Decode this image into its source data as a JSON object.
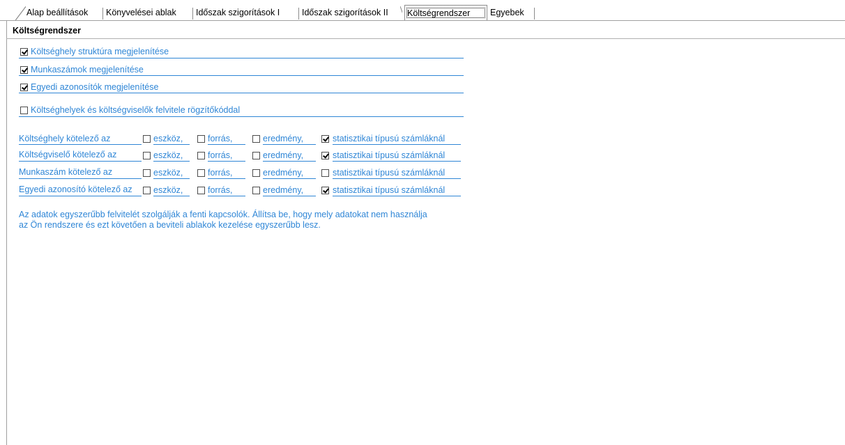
{
  "tabs": [
    {
      "label": "Alap beállítások"
    },
    {
      "label": "Könyvelései ablak"
    },
    {
      "label": "Időszak szigorítások I"
    },
    {
      "label": "Időszak szigorítások II"
    },
    {
      "label": "Költségrendszer",
      "active": true
    },
    {
      "label": "Egyebek"
    }
  ],
  "section_title": "Költségrendszer",
  "options": [
    {
      "label": "Költséghely struktúra megjelenítése",
      "checked": true
    },
    {
      "label": "Munkaszámok megjelenítése",
      "checked": true
    },
    {
      "label": "Egyedi azonosítók megjelenítése",
      "checked": true
    },
    {
      "label": "Költséghelyek és költségviselők felvitele rögzítőkóddal",
      "checked": false
    }
  ],
  "required_columns": [
    "eszköz,",
    "forrás,",
    "eredmény,",
    "statisztikai típusú számláknál"
  ],
  "required_rows": [
    {
      "label": "Költséghely kötelező az",
      "checks": [
        false,
        false,
        false,
        true
      ]
    },
    {
      "label": "Költségviselő kötelező az",
      "checks": [
        false,
        false,
        false,
        true
      ]
    },
    {
      "label": "Munkaszám kötelező az",
      "checks": [
        false,
        false,
        false,
        false
      ]
    },
    {
      "label": "Egyedi azonosító kötelező az",
      "checks": [
        false,
        false,
        false,
        true
      ]
    }
  ],
  "note_line1": "Az adatok egyszerűbb felvitelét szolgálják a fenti kapcsolók. Állítsa be, hogy mely adatokat nem használja",
  "note_line2": "az Ön rendszere és ezt követően a beviteli ablakok kezelése egyszerűbb lesz.",
  "colors": {
    "label_blue": "#2f86d6",
    "border_gray": "#8c8c8c"
  }
}
